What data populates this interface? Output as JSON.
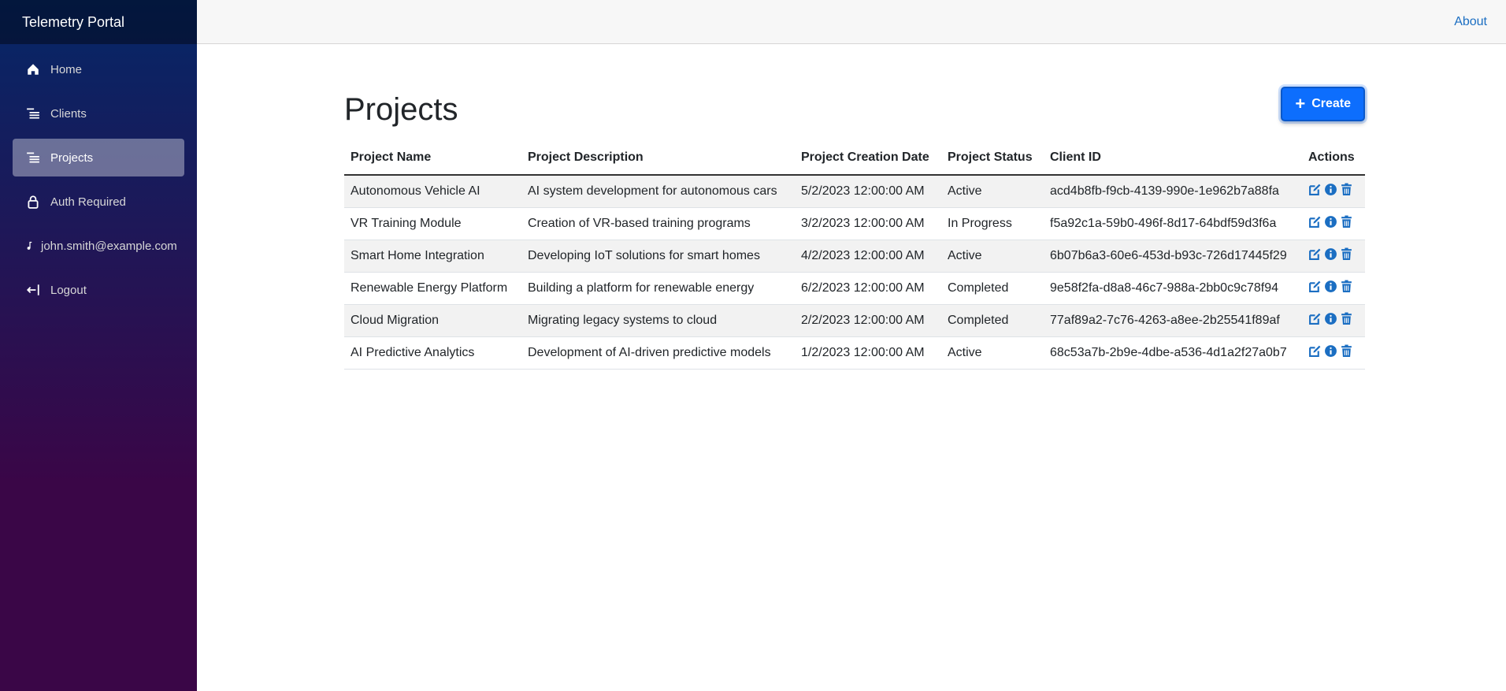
{
  "app": {
    "title": "Telemetry Portal"
  },
  "topbar": {
    "about_label": "About"
  },
  "sidebar": {
    "items": [
      {
        "label": "Home",
        "icon": "home-icon"
      },
      {
        "label": "Clients",
        "icon": "list-icon"
      },
      {
        "label": "Projects",
        "icon": "list-icon",
        "active": true
      },
      {
        "label": "Auth Required",
        "icon": "lock-icon"
      },
      {
        "label": "john.smith@example.com",
        "icon": "person-icon"
      },
      {
        "label": "Logout",
        "icon": "logout-icon"
      }
    ]
  },
  "page": {
    "title": "Projects",
    "create_label": "Create"
  },
  "table": {
    "headers": [
      "Project Name",
      "Project Description",
      "Project Creation Date",
      "Project Status",
      "Client ID",
      "Actions"
    ],
    "rows": [
      [
        "Autonomous Vehicle AI",
        "AI system development for autonomous cars",
        "5/2/2023 12:00:00 AM",
        "Active",
        "acd4b8fb-f9cb-4139-990e-1e962b7a88fa"
      ],
      [
        "VR Training Module",
        "Creation of VR-based training programs",
        "3/2/2023 12:00:00 AM",
        "In Progress",
        "f5a92c1a-59b0-496f-8d17-64bdf59d3f6a"
      ],
      [
        "Smart Home Integration",
        "Developing IoT solutions for smart homes",
        "4/2/2023 12:00:00 AM",
        "Active",
        "6b07b6a3-60e6-453d-b93c-726d17445f29"
      ],
      [
        "Renewable Energy Platform",
        "Building a platform for renewable energy",
        "6/2/2023 12:00:00 AM",
        "Completed",
        "9e58f2fa-d8a8-46c7-988a-2bb0c9c78f94"
      ],
      [
        "Cloud Migration",
        "Migrating legacy systems to cloud",
        "2/2/2023 12:00:00 AM",
        "Completed",
        "77af89a2-7c76-4263-a8ee-2b25541f89af"
      ],
      [
        "AI Predictive Analytics",
        "Development of AI-driven predictive models",
        "1/2/2023 12:00:00 AM",
        "Active",
        "68c53a7b-2b9e-4dbe-a536-4d1a2f27a0b7"
      ]
    ]
  },
  "colors": {
    "accent": "#0d6efd",
    "action_icon": "#1b6ec2",
    "sidebar_top": "#052767",
    "sidebar_bottom": "#3a0647"
  }
}
